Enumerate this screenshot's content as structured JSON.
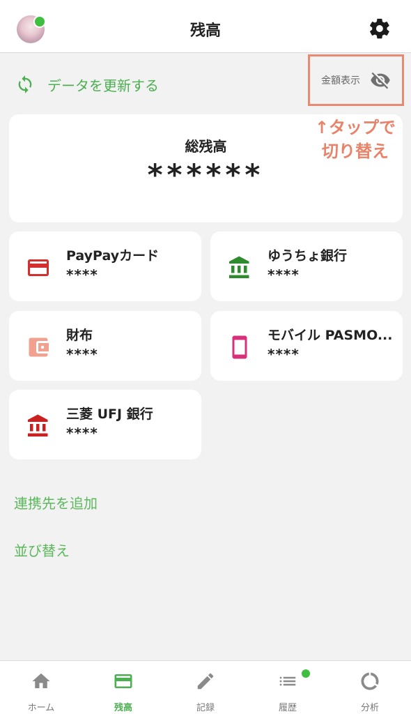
{
  "header": {
    "title": "残高"
  },
  "refresh": {
    "label": "データを更新する"
  },
  "amount_toggle": {
    "label": "金額表示",
    "icon": "eye-off-icon"
  },
  "annotation": {
    "line1": "↑タップで",
    "line2": "切り替え"
  },
  "total": {
    "label": "総残高",
    "value": "******"
  },
  "accounts": [
    {
      "name": "PayPayカード",
      "balance": "****",
      "icon": "credit-card-icon",
      "color": "#d32f2f"
    },
    {
      "name": "ゆうちょ銀行",
      "balance": "****",
      "icon": "bank-icon",
      "color": "#2e8b2e"
    },
    {
      "name": "財布",
      "balance": "****",
      "icon": "wallet-icon",
      "color": "#f2a08f"
    },
    {
      "name": "モバイル PASMO...",
      "balance": "****",
      "icon": "smartphone-icon",
      "color": "#d6317a"
    },
    {
      "name": "三菱 UFJ 銀行",
      "balance": "****",
      "icon": "bank-icon",
      "color": "#cc1f1f"
    }
  ],
  "links": {
    "add": "連携先を追加",
    "sort": "並び替え"
  },
  "tabs": [
    {
      "label": "ホーム",
      "icon": "home-icon"
    },
    {
      "label": "残高",
      "icon": "card-icon"
    },
    {
      "label": "記録",
      "icon": "pencil-icon"
    },
    {
      "label": "履歴",
      "icon": "list-icon"
    },
    {
      "label": "分析",
      "icon": "chart-ring-icon"
    }
  ],
  "colors": {
    "accent": "#4caf50",
    "annotation": "#e8836a"
  }
}
